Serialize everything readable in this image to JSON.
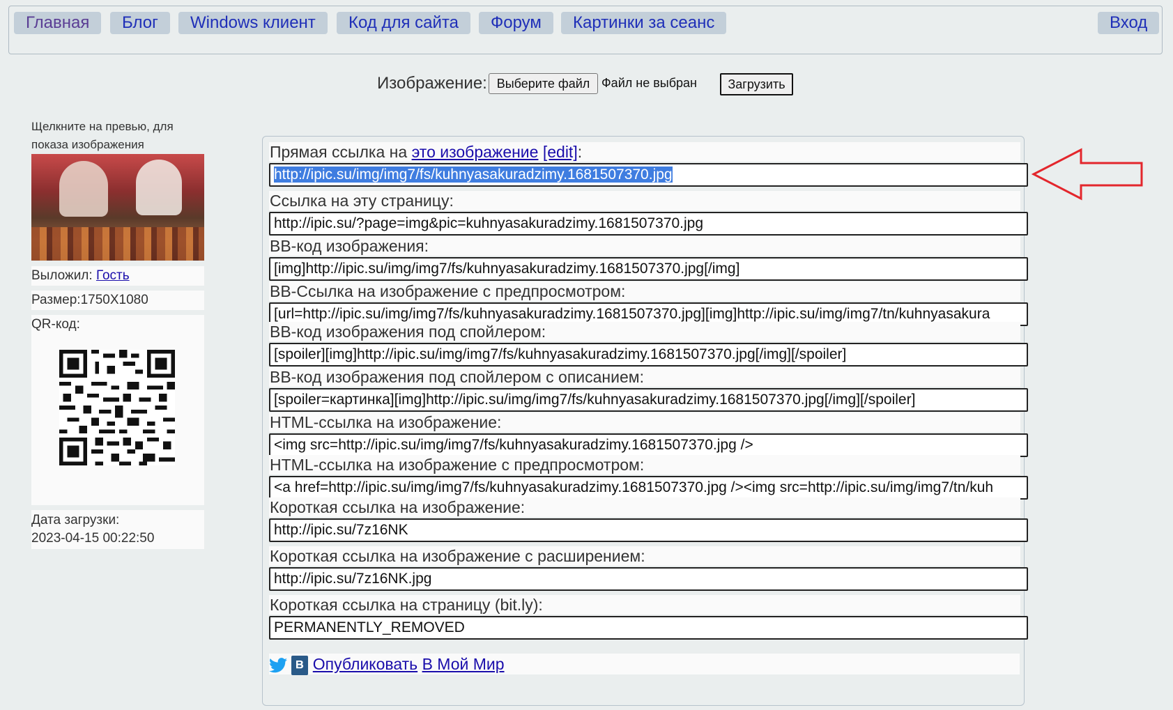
{
  "nav": {
    "items": [
      {
        "label": "Главная",
        "active": true
      },
      {
        "label": "Блог"
      },
      {
        "label": "Windows клиент"
      },
      {
        "label": "Код для сайта"
      },
      {
        "label": "Форум"
      },
      {
        "label": "Картинки за сеанс"
      }
    ],
    "login": "Вход"
  },
  "upload": {
    "label": "Изображение:",
    "choose_button": "Выберите файл",
    "no_file": "Файл не выбран",
    "submit_button": "Загрузить"
  },
  "sidebar": {
    "hint": "Щелкните на превью, для показа изображения",
    "uploader_label": "Выложил: ",
    "uploader_link": "Гость",
    "size": "Размер:1750X1080",
    "qr_label": "QR-код:",
    "date_label": "Дата загрузки:",
    "date_value": "2023-04-15 00:22:50"
  },
  "links": {
    "direct": {
      "prefix": "Прямая ссылка на ",
      "link": "это изображение",
      "edit": "[edit]",
      "suffix": ":",
      "value": "http://ipic.su/img/img7/fs/kuhnyasakuradzimy.1681507370.jpg"
    },
    "rows": [
      {
        "label": "Ссылка на эту страницу:",
        "value": "http://ipic.su/?page=img&pic=kuhnyasakuradzimy.1681507370.jpg"
      },
      {
        "label": "BB-код изображения:",
        "value": "[img]http://ipic.su/img/img7/fs/kuhnyasakuradzimy.1681507370.jpg[/img]"
      },
      {
        "label": "BB-Ссылка на изображение с предпросмотром:",
        "value": "[url=http://ipic.su/img/img7/fs/kuhnyasakuradzimy.1681507370.jpg][img]http://ipic.su/img/img7/tn/kuhnyasakura"
      },
      {
        "label": "BB-код изображения под спойлером:",
        "value": "[spoiler][img]http://ipic.su/img/img7/fs/kuhnyasakuradzimy.1681507370.jpg[/img][/spoiler]"
      },
      {
        "label": "BB-код изображения под спойлером с описанием:",
        "value": "[spoiler=картинка][img]http://ipic.su/img/img7/fs/kuhnyasakuradzimy.1681507370.jpg[/img][/spoiler]"
      },
      {
        "label": "HTML-ссылка на изображение:",
        "value": "<img src=http://ipic.su/img/img7/fs/kuhnyasakuradzimy.1681507370.jpg />"
      },
      {
        "label": "HTML-ссылка на изображение с предпросмотром:",
        "value": "<a href=http://ipic.su/img/img7/fs/kuhnyasakuradzimy.1681507370.jpg /><img src=http://ipic.su/img/img7/tn/kuh"
      },
      {
        "label": "Короткая ссылка на изображение:",
        "value": "http://ipic.su/7z16NK"
      },
      {
        "label": "Короткая ссылка на изображение с расширением:",
        "value": "http://ipic.su/7z16NK.jpg"
      },
      {
        "label": "Короткая ссылка на страницу (bit.ly):",
        "value": "PERMANENTLY_REMOVED"
      }
    ]
  },
  "share": {
    "publish": "Опубликовать",
    "mymir": "В Мой Мир"
  },
  "colors": {
    "accent_arrow": "#e3262c",
    "selection": "#3f7de0",
    "nav_bg": "#c3cfd9"
  }
}
